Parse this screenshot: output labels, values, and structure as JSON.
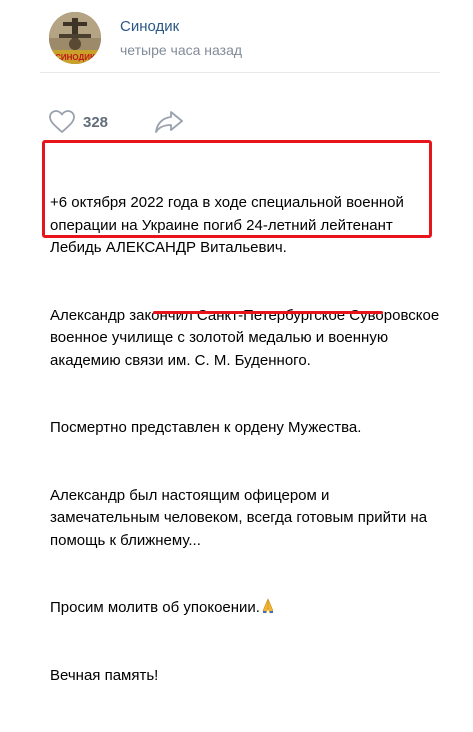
{
  "post": {
    "author": "Синодик",
    "time": "четыре часа назад",
    "avatar_text": "СИНОДИК",
    "likes": "328",
    "paragraphs": [
      "+6 октября 2022 года в ходе специальной военной операции на Украине погиб 24-летний лейтенант Лебидь АЛЕКСАНДР Витальевич.",
      "Александр закончил Санкт-Петербургское Суворовское военное училище с золотой медалью и военную академию связи им. С. М. Буденного.",
      "Посмертно представлен к ордену Мужества.",
      "Александр был настоящим офицером и замечательным человеком, всегда готовым прийти на помощь к ближнему...",
      "Просим молитв об упокоении.",
      "Вечная память!"
    ]
  },
  "colors": {
    "link": "#2a5885",
    "muted": "#818c99",
    "annotation": "#e8141c"
  },
  "icons": {
    "like": "heart-outline-icon",
    "share": "share-arrow-icon",
    "emoji": "praying-hands-emoji"
  }
}
